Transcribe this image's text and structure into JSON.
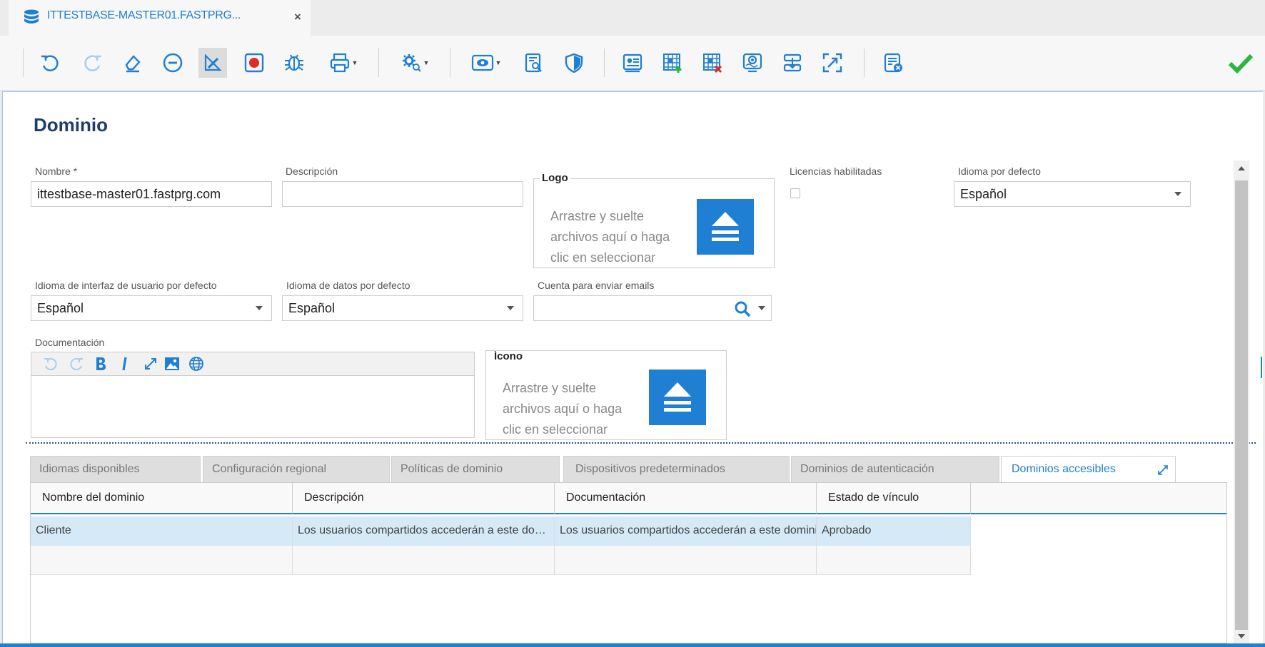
{
  "tab": {
    "title": "ITTESTBASE-MASTER01.FASTPRG...",
    "close": "×"
  },
  "toolbar": {
    "icons": [
      "undo-icon",
      "redo-icon",
      "eraser-icon",
      "remove-icon",
      "edit-pencil-icon",
      "record-icon",
      "bug-icon",
      "print-icon",
      "settings-search-icon",
      "view-icon",
      "document-search-icon",
      "shield-icon",
      "id-card-icon",
      "table-add-icon",
      "table-delete-icon",
      "monitor-eye-icon",
      "text-height-icon",
      "expand-icon",
      "list-clear-icon",
      "check-icon"
    ],
    "accept_color": "#2db540"
  },
  "form": {
    "title": "Dominio",
    "nombre": {
      "label": "Nombre *",
      "value": "ittestbase-master01.fastprg.com"
    },
    "descripcion": {
      "label": "Descripción",
      "value": ""
    },
    "logo": {
      "legend": "Logo",
      "text_lines": [
        "Arrastre y suelte",
        "archivos aquí o haga",
        "clic en seleccionar"
      ]
    },
    "licencias": {
      "label": "Licencias habilitadas",
      "checked": false
    },
    "idioma_defecto": {
      "label": "Idioma por defecto",
      "value": "Español"
    },
    "idioma_interfaz": {
      "label": "Idioma de interfaz de usuario por defecto",
      "value": "Español"
    },
    "idioma_datos": {
      "label": "Idioma de datos por defecto",
      "value": "Español"
    },
    "cuenta_emails": {
      "label": "Cuenta para enviar emails",
      "value": ""
    },
    "documentacion": {
      "label": "Documentación"
    },
    "icono": {
      "legend": "Ícono",
      "text_lines": [
        "Arrastre y suelte",
        "archivos aquí o haga",
        "clic en seleccionar"
      ]
    }
  },
  "tabs": [
    {
      "label": "Idiomas disponibles",
      "active": false
    },
    {
      "label": "Configuración regional",
      "active": false
    },
    {
      "label": "Políticas de dominio",
      "active": false
    },
    {
      "label": "Dispositivos predeterminados",
      "active": false
    },
    {
      "label": "Dominios de autenticación",
      "active": false
    },
    {
      "label": "Dominios accesibles",
      "active": true
    }
  ],
  "grid": {
    "columns": [
      "Nombre del dominio",
      "Descripción",
      "Documentación",
      "Estado de vínculo"
    ],
    "rows": [
      [
        "Cliente",
        "Los usuarios compartidos accederán a este dominio",
        "Los usuarios compartidos accederán a este dominio",
        "Aprobado"
      ]
    ]
  },
  "colors": {
    "accent": "#1f7fd2",
    "title": "#1f3c6e",
    "selected_row": "#d5e9f7"
  }
}
